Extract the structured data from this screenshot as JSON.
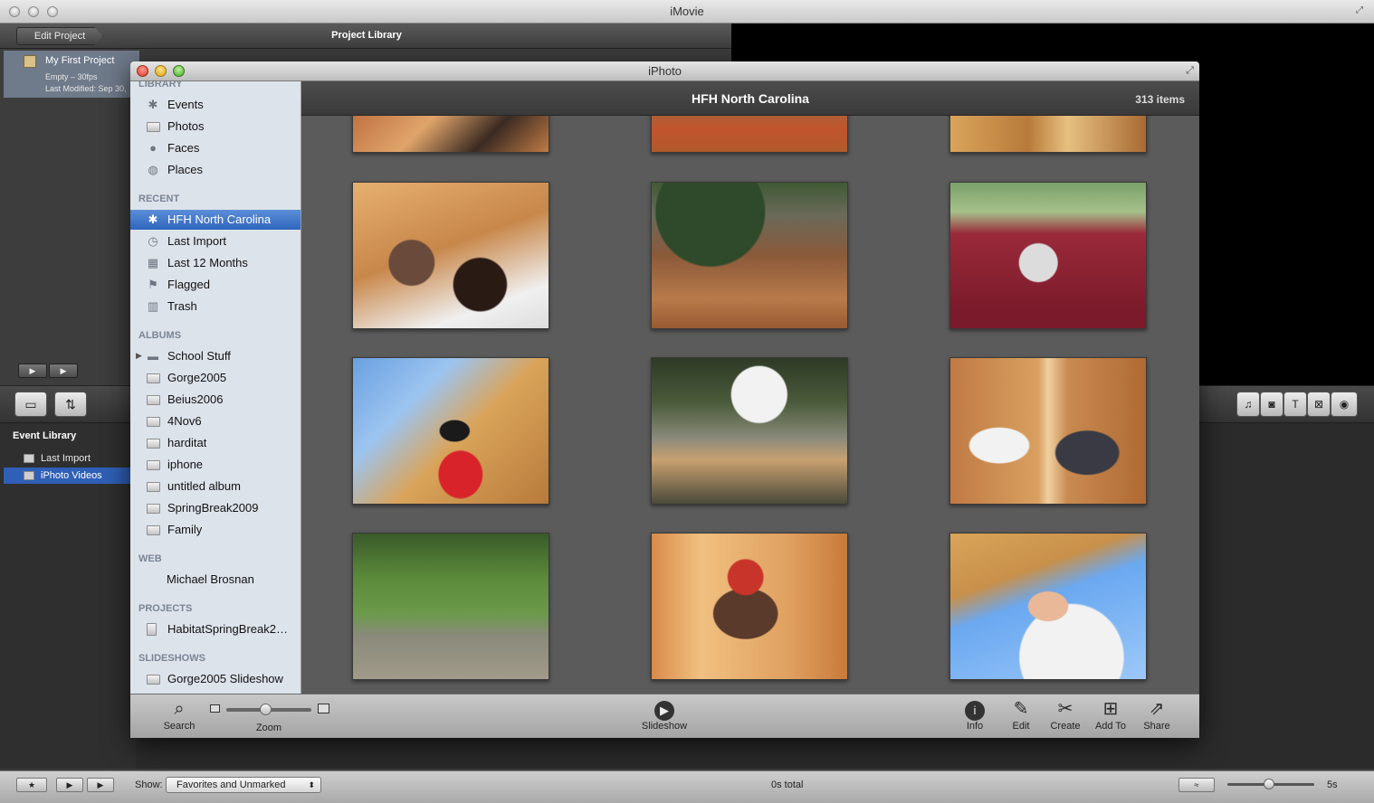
{
  "imovie": {
    "window_title": "iMovie",
    "edit_project_label": "Edit Project",
    "project_library_title": "Project Library",
    "project": {
      "name": "My First Project",
      "meta1": "Empty – 30fps",
      "meta2": "Last Modified: Sep 30,"
    },
    "event_library": {
      "title": "Event Library",
      "items": [
        "Last Import",
        "iPhoto Videos"
      ]
    },
    "bottombar": {
      "show_label": "Show:",
      "show_value": "Favorites and Unmarked",
      "total": "0s total",
      "duration": "5s"
    }
  },
  "iphoto": {
    "window_title": "iPhoto",
    "library": {
      "heading": "LIBRARY",
      "items": [
        {
          "label": "Events",
          "icon": "palm-icon"
        },
        {
          "label": "Photos",
          "icon": "photos-icon"
        },
        {
          "label": "Faces",
          "icon": "person-icon"
        },
        {
          "label": "Places",
          "icon": "globe-icon"
        }
      ]
    },
    "recent": {
      "heading": "RECENT",
      "items": [
        {
          "label": "HFH North Carolina",
          "icon": "palm-icon",
          "selected": true
        },
        {
          "label": "Last Import",
          "icon": "clock-icon"
        },
        {
          "label": "Last 12 Months",
          "icon": "calendar-icon"
        },
        {
          "label": "Flagged",
          "icon": "flag-icon"
        },
        {
          "label": "Trash",
          "icon": "trash-icon"
        }
      ]
    },
    "albums": {
      "heading": "ALBUMS",
      "items": [
        "School Stuff",
        "Gorge2005",
        "Beius2006",
        "4Nov6",
        "harditat",
        "iphone",
        "untitled album",
        "SpringBreak2009",
        "Family"
      ]
    },
    "web": {
      "heading": "WEB",
      "items": [
        "Michael Brosnan"
      ]
    },
    "projects": {
      "heading": "PROJECTS",
      "items": [
        "HabitatSpringBreak2…"
      ]
    },
    "slideshows": {
      "heading": "SLIDESHOWS",
      "items": [
        "Gorge2005 Slideshow"
      ]
    },
    "content": {
      "album_title": "HFH North Carolina",
      "item_count": "313 items"
    },
    "toolbar": {
      "search": "Search",
      "zoom": "Zoom",
      "slideshow": "Slideshow",
      "info": "Info",
      "edit": "Edit",
      "create": "Create",
      "add_to": "Add To",
      "share": "Share"
    }
  }
}
